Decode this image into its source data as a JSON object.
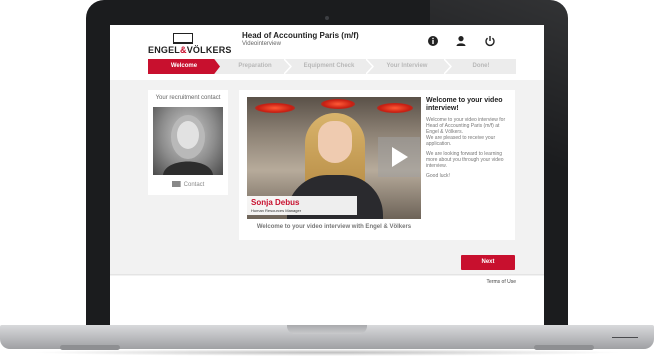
{
  "brand": {
    "logo_text_a": "ENGEL",
    "logo_amp": "&",
    "logo_text_b": "VÖLKERS",
    "accent": "#c8102e"
  },
  "header": {
    "job_title": "Head of Accounting Paris (m/f)",
    "subtitle": "Videointerview",
    "icons": [
      "info-icon",
      "user-icon",
      "power-icon"
    ]
  },
  "steps": {
    "items": [
      {
        "label": "Welcome"
      },
      {
        "label": "Preparation"
      },
      {
        "label": "Equipment Check"
      },
      {
        "label": "Your Interview"
      },
      {
        "label": "Done!"
      }
    ],
    "active": "Welcome"
  },
  "contact": {
    "title": "Your recruitment contact",
    "button_label": "Contact"
  },
  "video": {
    "name": "Sonja Debus",
    "role": "Human Resources Manager",
    "caption": "Welcome to your video interview with Engel & Völkers"
  },
  "welcome": {
    "title": "Welcome to your video interview!",
    "p1": "Welcome to your video interview for Head of Accounting Paris (m/f) at Engel & Völkers.",
    "p2": "We are pleased to receive your application.",
    "p3": "We are looking forward to learning more about you through your video interview.",
    "p4": "Good luck!"
  },
  "actions": {
    "next_label": "Next"
  },
  "footer": {
    "terms_label": "Terms of Use"
  }
}
